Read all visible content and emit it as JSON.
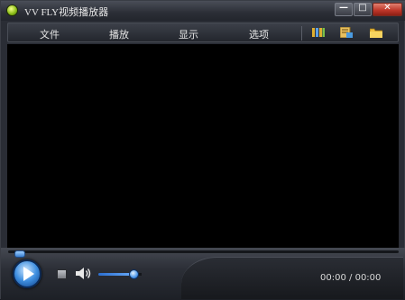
{
  "window": {
    "title": "VV FLY视频播放器",
    "buttons": {
      "minimize": "—",
      "maximize": "□",
      "close": "✕"
    }
  },
  "menu": {
    "items": [
      {
        "label": "文件"
      },
      {
        "label": "播放"
      },
      {
        "label": "显示"
      },
      {
        "label": "选项"
      }
    ],
    "toolbar_icons": [
      "playlist-icon",
      "edit-icon",
      "open-folder-icon"
    ]
  },
  "controls": {
    "seek_progress": 0,
    "volume_level": 0.75,
    "current_time": "00:00",
    "time_separator": "/",
    "total_time": "00:00"
  },
  "colors": {
    "accent": "#3f8fe0",
    "close_button": "#c0392b",
    "video_background": "#000000"
  }
}
